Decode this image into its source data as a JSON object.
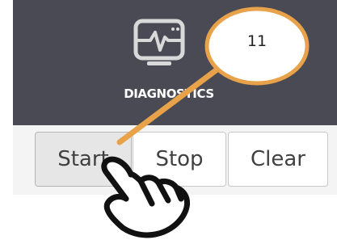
{
  "panel": {
    "title": "DIAGNOSTICS",
    "icon": "diagnostics-monitor-icon"
  },
  "toolbar": {
    "start_label": "Start",
    "stop_label": "Stop",
    "clear_label": "Clear"
  },
  "annotation": {
    "callout_number": "11",
    "callout_color": "#e8a24a",
    "pointer_icon": "hand-pointer-icon"
  }
}
